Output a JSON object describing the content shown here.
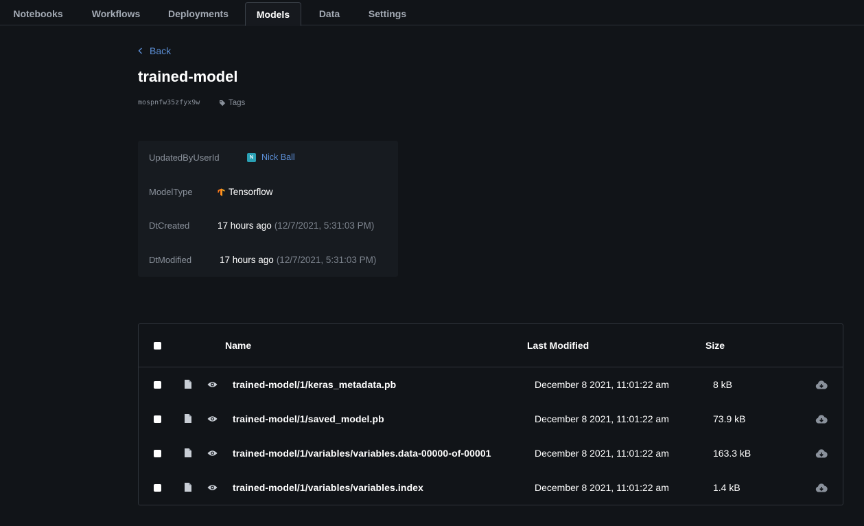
{
  "nav": {
    "tabs": [
      {
        "label": "Notebooks"
      },
      {
        "label": "Workflows"
      },
      {
        "label": "Deployments"
      },
      {
        "label": "Models",
        "active": true
      },
      {
        "label": "Data"
      },
      {
        "label": "Settings"
      }
    ]
  },
  "header": {
    "back_label": "Back",
    "title": "trained-model",
    "model_id": "mospnfw35zfyx9w",
    "tags_label": "Tags"
  },
  "details": {
    "updated_by": {
      "label": "UpdatedByUserId",
      "avatar_initial": "N",
      "user_name": "Nick Ball"
    },
    "model_type": {
      "label": "ModelType",
      "value": "Tensorflow",
      "icon": "tensorflow-icon"
    },
    "dt_created": {
      "label": "DtCreated",
      "relative": "17 hours ago",
      "absolute": "(12/7/2021, 5:31:03 PM)"
    },
    "dt_modified": {
      "label": "DtModified",
      "relative": "17 hours ago",
      "absolute": "(12/7/2021, 5:31:03 PM)"
    }
  },
  "files": {
    "columns": {
      "name": "Name",
      "last_modified": "Last Modified",
      "size": "Size"
    },
    "rows": [
      {
        "name": "trained-model/1/keras_metadata.pb",
        "last_modified": "December 8 2021, 11:01:22 am",
        "size": "8 kB"
      },
      {
        "name": "trained-model/1/saved_model.pb",
        "last_modified": "December 8 2021, 11:01:22 am",
        "size": "73.9 kB"
      },
      {
        "name": "trained-model/1/variables/variables.data-00000-of-00001",
        "last_modified": "December 8 2021, 11:01:22 am",
        "size": "163.3 kB"
      },
      {
        "name": "trained-model/1/variables/variables.index",
        "last_modified": "December 8 2021, 11:01:22 am",
        "size": "1.4 kB"
      }
    ]
  },
  "colors": {
    "background": "#111418",
    "link": "#5c8fd6",
    "muted": "#8a919b",
    "avatar": "#2aa0b4",
    "tensorflow": "#f5a623"
  }
}
